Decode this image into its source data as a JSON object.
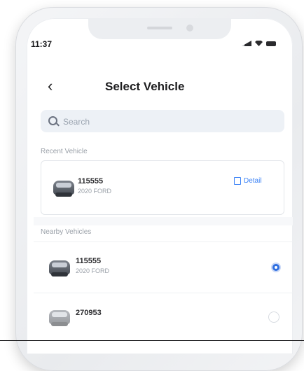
{
  "status": {
    "time": "11:37"
  },
  "header": {
    "title": "Select Vehicle",
    "back_glyph": "‹"
  },
  "search": {
    "placeholder": "Search"
  },
  "recent": {
    "heading": "Recent Vehicle",
    "vehicle": {
      "id": "115555",
      "info": "2020 FORD"
    },
    "detail_label": "Detail"
  },
  "nearby": {
    "heading": "Nearby Vehicles",
    "vehicles": [
      {
        "id": "115555",
        "info": "2020 FORD",
        "selected": true
      },
      {
        "id": "270953",
        "info": "",
        "selected": false
      }
    ]
  },
  "colors": {
    "accent": "#2f6fe0",
    "link": "#3b82f6"
  },
  "icons": [
    "back-icon",
    "search-icon",
    "vehicle-icon",
    "detail-icon",
    "radio-selected-icon",
    "radio-unselected-icon",
    "signal-icon",
    "wifi-icon",
    "battery-icon"
  ]
}
